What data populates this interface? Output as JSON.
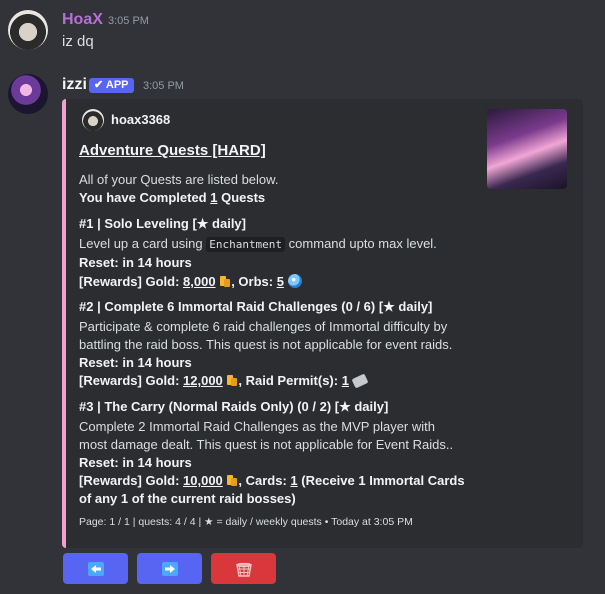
{
  "messages": [
    {
      "username": "HoaX",
      "timestamp": "3:05 PM",
      "content": "iz dq"
    },
    {
      "username": "izzi",
      "badge": "APP",
      "timestamp": "3:05 PM"
    }
  ],
  "embed": {
    "author": "hoax3368",
    "title": "Adventure Quests [HARD]",
    "intro": "All of your Quests are listed below.",
    "completed_prefix": "You have Completed ",
    "completed_count": "1",
    "completed_suffix": " Quests",
    "quests": [
      {
        "header": "#1 | Solo Leveling [★ daily]",
        "desc1_pre": "Level up a card using ",
        "desc1_code": "Enchantment",
        "desc1_post": " command upto max level.",
        "reset_label": "Reset:",
        "reset_value": "in 14 hours",
        "reward_prefix": "[Rewards] Gold: ",
        "gold": "8,000",
        "extra_label": ", Orbs: ",
        "extra_value": "5"
      },
      {
        "header": "#2 | Complete 6 Immortal Raid Challenges (0 / 6) [★ daily]",
        "desc1": "Participate & complete 6 raid challenges of Immortal difficulty by",
        "desc2": "battling the raid boss. This quest is not applicable for event raids.",
        "reset_label": "Reset:",
        "reset_value": "in 14 hours",
        "reward_prefix": "[Rewards] Gold: ",
        "gold": "12,000",
        "extra_label": ", Raid Permit(s): ",
        "extra_value": "1"
      },
      {
        "header": "#3 | The Carry (Normal Raids Only) (0 / 2) [★ daily]",
        "desc1": "Complete 2 Immortal Raid Challenges as the MVP player with",
        "desc2": "most damage dealt. This quest is not applicable for Event Raids..",
        "reset_label": "Reset:",
        "reset_value": "in 14 hours",
        "reward_prefix": "[Rewards] Gold: ",
        "gold": "10,000",
        "extra_label": ", Cards: ",
        "extra_value": "1",
        "extra_note": " (Receive 1 Immortal Cards",
        "extra_note2": "of any 1 of the current raid bosses)"
      }
    ],
    "footer": "Page: 1 / 1 | quests: 4 / 4 | ★ = daily / weekly quests • Today at 3:05 PM"
  },
  "buttons": {
    "prev": "🡄",
    "next": "🡆",
    "close": "🗑"
  },
  "colors": {
    "accent": "#f0a1d0",
    "blurple": "#5865f2",
    "danger": "#da373c",
    "hoax_name": "#b66fd6"
  }
}
